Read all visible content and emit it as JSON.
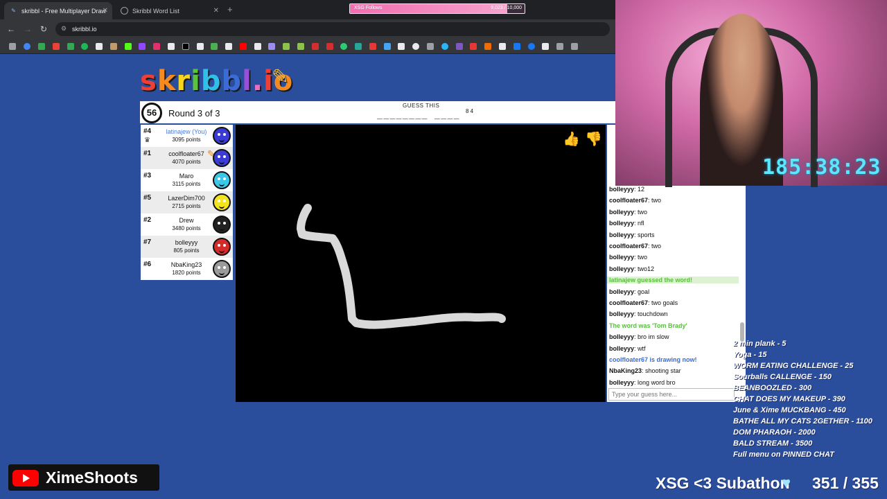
{
  "browser": {
    "tabs": [
      {
        "title": "skribbl - Free Multiplayer Draw",
        "active": true
      },
      {
        "title": "Skribbl Word List",
        "active": false
      }
    ],
    "address": "skribbl.io",
    "xsg_follows": {
      "label": "XSG Follows",
      "count": "9,023 / 10,000",
      "progress": 0.9023
    }
  },
  "game": {
    "logo": "skribbl.io",
    "timer": "56",
    "round": "Round 3 of 3",
    "guess_label": "GUESS THIS",
    "word_pattern": "________ ____",
    "word_lengths": "8 4",
    "players": [
      {
        "rank": "#4",
        "name": "latinajew (You)",
        "points": "3095 points",
        "color": "#3b3bd6",
        "you": true,
        "crown": true
      },
      {
        "rank": "#1",
        "name": "coolfloater67",
        "points": "4070 points",
        "color": "#3b3bd6",
        "drawing": true
      },
      {
        "rank": "#3",
        "name": "Maro",
        "points": "3115 points",
        "color": "#3ac7e8"
      },
      {
        "rank": "#5",
        "name": "LazerDim700",
        "points": "2715 points",
        "color": "#f2e51e"
      },
      {
        "rank": "#2",
        "name": "Drew",
        "points": "3480 points",
        "color": "#222222"
      },
      {
        "rank": "#7",
        "name": "bolleyyy",
        "points": "805 points",
        "color": "#d42a2a"
      },
      {
        "rank": "#6",
        "name": "NbaKing23",
        "points": "1820 points",
        "color": "#9a9a9a"
      }
    ],
    "chat": [
      {
        "user": "bolleyyy",
        "text": "12"
      },
      {
        "user": "coolfloater67",
        "text": "two"
      },
      {
        "user": "bolleyyy",
        "text": "two"
      },
      {
        "user": "bolleyyy",
        "text": "nfl"
      },
      {
        "user": "bolleyyy",
        "text": "sports"
      },
      {
        "user": "coolfloater67",
        "text": "two"
      },
      {
        "user": "bolleyyy",
        "text": "two"
      },
      {
        "user": "bolleyyy",
        "text": "two12"
      },
      {
        "system": "latinajew guessed the word!",
        "style": "green-hl"
      },
      {
        "user": "bolleyyy",
        "text": "goal"
      },
      {
        "user": "coolfloater67",
        "text": "two goals"
      },
      {
        "user": "bolleyyy",
        "text": "touchdown"
      },
      {
        "system": "The word was 'Tom Brady'",
        "style": "green"
      },
      {
        "user": "bolleyyy",
        "text": "bro im slow"
      },
      {
        "user": "bolleyyy",
        "text": "wtf"
      },
      {
        "system": "coolfloater67 is drawing now!",
        "style": "blue"
      },
      {
        "user": "NbaKing23",
        "text": "shooting star"
      },
      {
        "user": "bolleyyy",
        "text": "long word bro"
      }
    ],
    "chat_placeholder": "Type your guess here..."
  },
  "stream": {
    "timer": "185:38:23",
    "menu": [
      "2 min plank - 5",
      "Yoga - 15",
      "WORM EATING CHALLENGE - 25",
      "Sourballs CALLENGE - 150",
      "BEANBOOZLED - 300",
      "CHAT DOES MY MAKEUP - 390",
      "June & Xime MUCKBANG - 450",
      "BATHE ALL MY CATS 2GETHER - 1100",
      "DOM PHARAOH - 2000",
      "BALD STREAM - 3500",
      "Full menu on PINNED CHAT"
    ],
    "channel": "XimeShoots",
    "subathon": "XSG <3 Subathon",
    "sub_count": "351 / 355"
  },
  "colors": {
    "bg": "#2a4e9c",
    "canvas": "#000000",
    "stroke": "#d9d9d9",
    "timer": "#5ee6ff"
  }
}
